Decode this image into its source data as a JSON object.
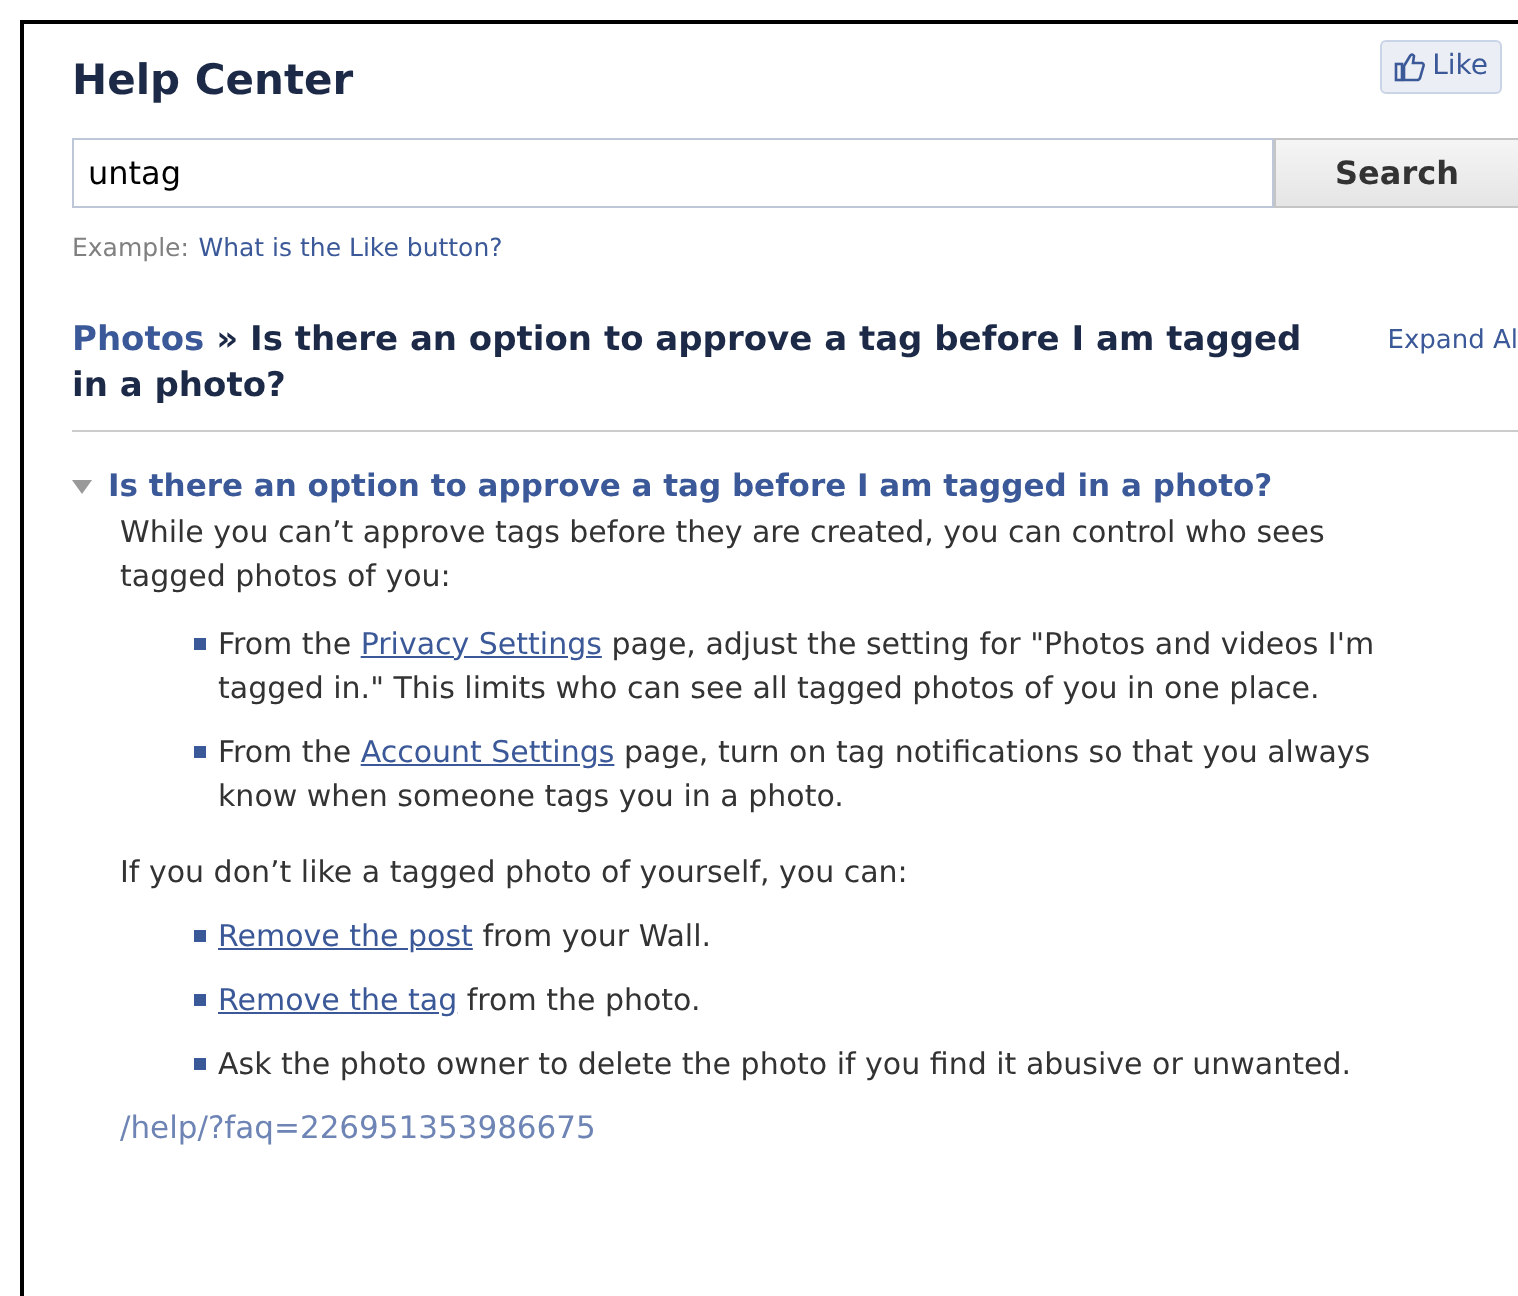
{
  "header": {
    "title": "Help Center",
    "like_button": "Like"
  },
  "search": {
    "value": "untag",
    "button": "Search",
    "example_label": "Example:",
    "example_link": "What is the Like button?"
  },
  "breadcrumb": {
    "section": "Photos",
    "separator": "»",
    "title": "Is there an option to approve a tag before I am tagged in a photo?",
    "expand_all": "Expand Al"
  },
  "faq": {
    "question": "Is there an option to approve a tag before I am tagged in a photo?",
    "expanded": true,
    "intro": "While you can’t approve tags before they are created, you can control who sees tagged photos of you:",
    "list_1": [
      {
        "kind": "link",
        "before": "From the ",
        "link": "Privacy Settings",
        "after": " page, adjust the setting for \"Photos and videos I'm tagged in.\" This limits who can see all tagged photos of you in one place."
      },
      {
        "kind": "link",
        "before": "From the ",
        "link": "Account Settings",
        "after": " page, turn on tag notifications so that you always know when someone tags you in a photo."
      }
    ],
    "middle": "If you don’t like a tagged photo of yourself, you can:",
    "list_2": [
      {
        "kind": "link",
        "link": "Remove the post",
        "after": " from your Wall."
      },
      {
        "kind": "link",
        "link": "Remove the tag",
        "after": " from the photo."
      },
      {
        "kind": "text",
        "text": "Ask the photo owner to delete the photo if you find it abusive or unwanted."
      }
    ],
    "permalink": "/help/?faq=226951353986675"
  }
}
